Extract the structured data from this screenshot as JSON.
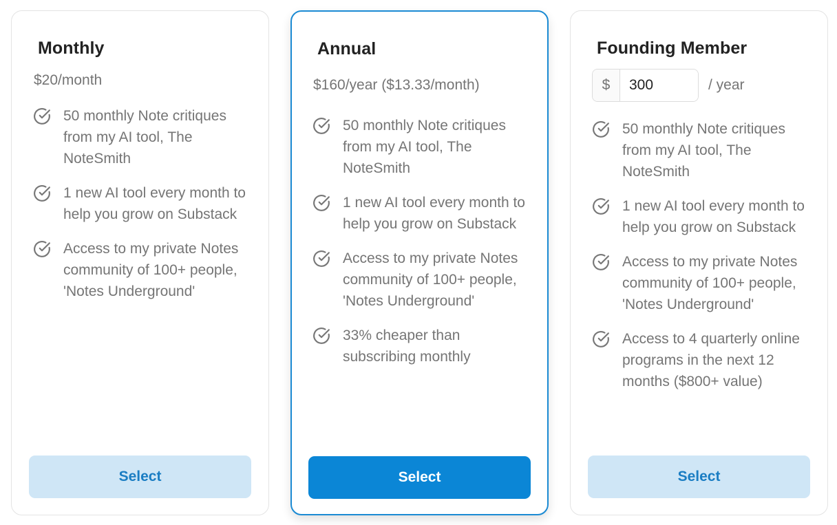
{
  "plans": [
    {
      "name": "Monthly",
      "price": "$20/month",
      "features": [
        "50 monthly Note critiques from my AI tool, The NoteSmith",
        "1 new AI tool every month to help you grow on Substack",
        "Access to my private Notes community of 100+ people, 'Notes Underground'"
      ],
      "button_label": "Select"
    },
    {
      "name": "Annual",
      "price": "$160/year ($13.33/month)",
      "features": [
        "50 monthly Note critiques from my AI tool, The NoteSmith",
        "1 new AI tool every month to help you grow on Substack",
        "Access to my private Notes community of 100+ people, 'Notes Underground'",
        "33% cheaper than subscribing monthly"
      ],
      "button_label": "Select"
    },
    {
      "name": "Founding Member",
      "currency_symbol": "$",
      "amount_value": "300",
      "amount_suffix": "/ year",
      "features": [
        "50 monthly Note critiques from my AI tool, The NoteSmith",
        "1 new AI tool every month to help you grow on Substack",
        "Access to my private Notes community of 100+ people, 'Notes Underground'",
        "Access to 4 quarterly online programs in the next 12 months ($800+ value)"
      ],
      "button_label": "Select"
    }
  ],
  "icons": {
    "feature": "check-circle-icon"
  },
  "colors": {
    "accent": "#0b86d6",
    "selected_border": "#1a8ad3",
    "light_button_bg": "#cfe6f6",
    "light_button_text": "#1a7dc3",
    "muted_text": "#757575"
  }
}
